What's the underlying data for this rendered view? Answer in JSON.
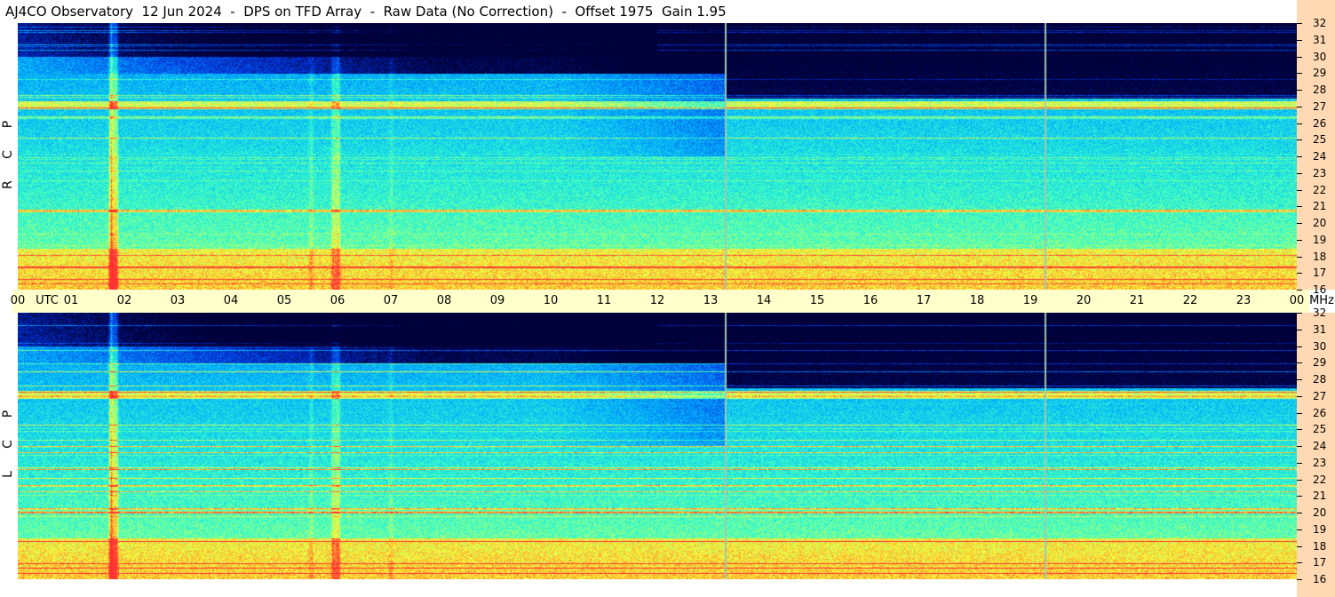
{
  "title": "AJ4CO Observatory  12 Jun 2024  -  DPS on TFD Array  -  Raw Data (No Correction)  -  Offset 1975  Gain 1.95",
  "colors": {
    "time_axis_bg": "#ffffcc",
    "freq_axis_bg": "#ffd9b3",
    "panel_bg": "#000000"
  },
  "chart_data": [
    {
      "type": "heatmap",
      "name": "RCP",
      "polarization_letters": [
        "R",
        "C",
        "P"
      ],
      "x_unit": "UTC",
      "xlim": [
        0,
        24
      ],
      "x_tick_labels": [
        "00",
        "01",
        "02",
        "03",
        "04",
        "05",
        "06",
        "07",
        "08",
        "09",
        "10",
        "11",
        "12",
        "13",
        "14",
        "15",
        "16",
        "17",
        "18",
        "19",
        "20",
        "21",
        "22",
        "23",
        "00"
      ],
      "y_unit": "MHz",
      "ylim": [
        16,
        32
      ],
      "y_ticks": [
        16,
        17,
        18,
        19,
        20,
        21,
        22,
        23,
        24,
        25,
        26,
        27,
        28,
        29,
        30,
        31,
        32
      ],
      "markers_utc": [
        13.27,
        19.27
      ],
      "colormap": [
        "#00003a",
        "#0033dd",
        "#00aaff",
        "#33ffcc",
        "#ffff33",
        "#ff3333"
      ]
    },
    {
      "type": "heatmap",
      "name": "LCP",
      "polarization_letters": [
        "L",
        "C",
        "P"
      ],
      "x_unit": "UTC",
      "xlim": [
        0,
        24
      ],
      "y_unit": "MHz",
      "ylim": [
        16,
        32
      ],
      "y_ticks": [
        16,
        17,
        18,
        19,
        20,
        21,
        22,
        23,
        24,
        25,
        26,
        27,
        28,
        29,
        30,
        31,
        32
      ],
      "markers_utc": [
        13.27,
        19.27
      ],
      "colormap": [
        "#00003a",
        "#0033dd",
        "#00aaff",
        "#33ffcc",
        "#ffff33",
        "#ff3333"
      ]
    }
  ]
}
